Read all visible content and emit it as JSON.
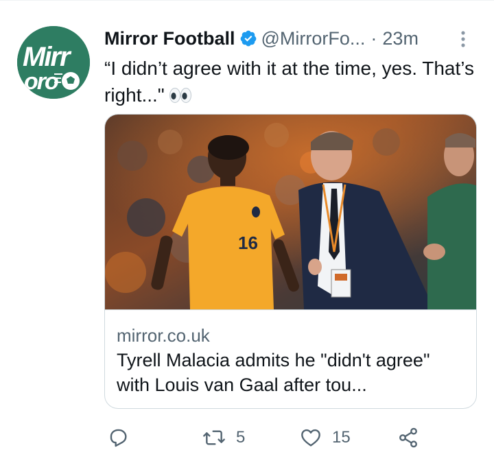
{
  "tweet": {
    "author_name": "Mirror Football",
    "handle": "@MirrorFo...",
    "separator": "·",
    "timestamp": "23m",
    "text": "“I didn’t agree with it at the time, yes. That’s right...\"",
    "emoji": "eyes",
    "verified": true
  },
  "avatar": {
    "brand": "Mirror",
    "color": "#2e7d62"
  },
  "card": {
    "domain": "mirror.co.uk",
    "title": "Tyrell Malacia admits he \"didn't agree\" with Louis van Gaal after tou...",
    "image_subject": "player-and-coach-photo",
    "jersey_number": "16"
  },
  "actions": {
    "reply_count": "",
    "retweet_count": "5",
    "like_count": "15"
  },
  "colors": {
    "text_primary": "#0f1419",
    "text_secondary": "#536471",
    "verified_blue": "#1d9bf0",
    "border": "#cfd9de"
  }
}
